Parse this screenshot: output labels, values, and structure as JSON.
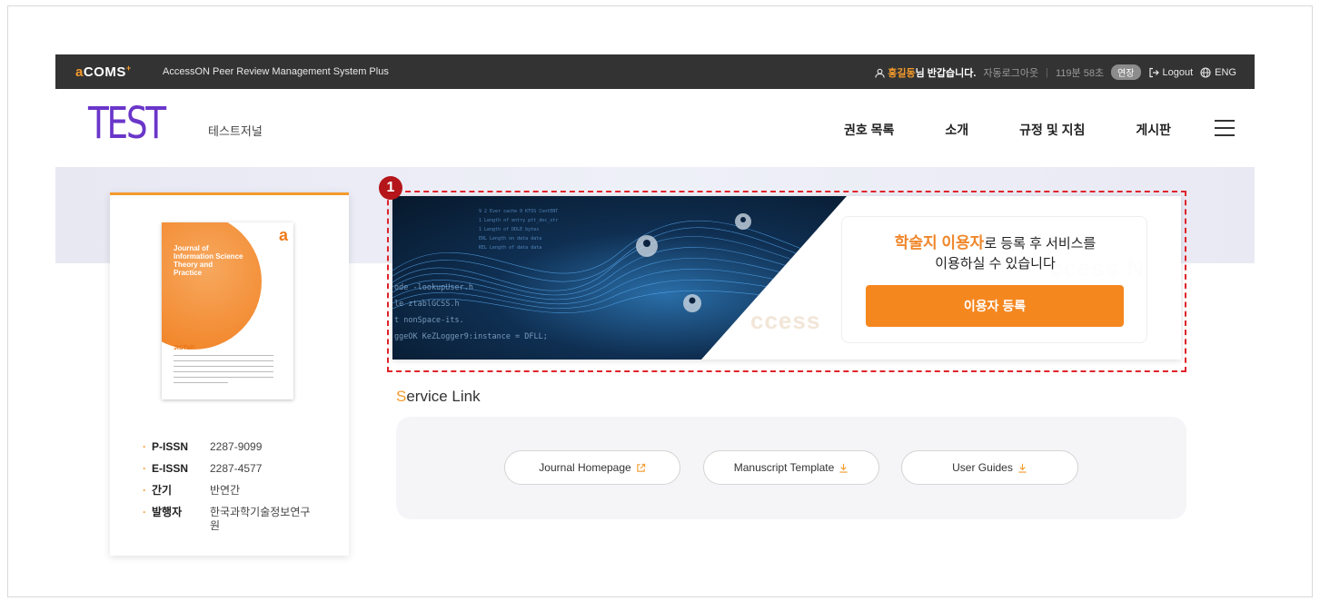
{
  "topbar": {
    "logo_a": "a",
    "logo_rest": "COMS",
    "logo_sup": "+",
    "system_name": "AccessON Peer Review Management System Plus",
    "user_name": "홍길동",
    "greeting_suffix": "님 반갑습니다.",
    "auto_logout_label": "자동로그아웃",
    "remaining_time": "119분 58초",
    "extend_label": "연장",
    "logout_label": "Logout",
    "lang_label": "ENG"
  },
  "header": {
    "journal_logo_text": "TEST",
    "journal_name": "테스트저널",
    "nav": [
      "권호 목록",
      "소개",
      "규정 및 지침",
      "게시판"
    ]
  },
  "sidebar_card": {
    "cover": {
      "title_lines": [
        "Journal of",
        "Information Science",
        "Theory and",
        "Practice"
      ],
      "tag": "JISTaP"
    },
    "info": [
      {
        "label": "P-ISSN",
        "value": "2287-9099"
      },
      {
        "label": "E-ISSN",
        "value": "2287-4577"
      },
      {
        "label": "간기",
        "value": "반연간"
      },
      {
        "label": "발행자",
        "value": "한국과학기술정보연구원"
      }
    ]
  },
  "banner": {
    "marker_number": "1",
    "message_highlight": "학술지 이용자",
    "message_line1_rest": "로 등록 후 서비스를",
    "message_line2": "이용하실 수 있습니다",
    "register_button": "이용자 등록",
    "code_lines": [
      "ode -lookupUser.h",
      "le ztablGCSS.h",
      "t nonSpace-its.",
      "ggeOK KeZLogger9:instance = DFLL;"
    ]
  },
  "service": {
    "title_first": "S",
    "title_rest": "ervice Link",
    "buttons": [
      {
        "label": "Journal Homepage",
        "icon": "external-link-icon"
      },
      {
        "label": "Manuscript Template",
        "icon": "download-icon"
      },
      {
        "label": "User Guides",
        "icon": "download-icon"
      }
    ]
  },
  "colors": {
    "accent": "#f39a2b",
    "brand_purple": "#6a36c9",
    "topbar_bg": "#333333",
    "marker_red": "#b5161b",
    "dash_red": "#e0232b"
  }
}
